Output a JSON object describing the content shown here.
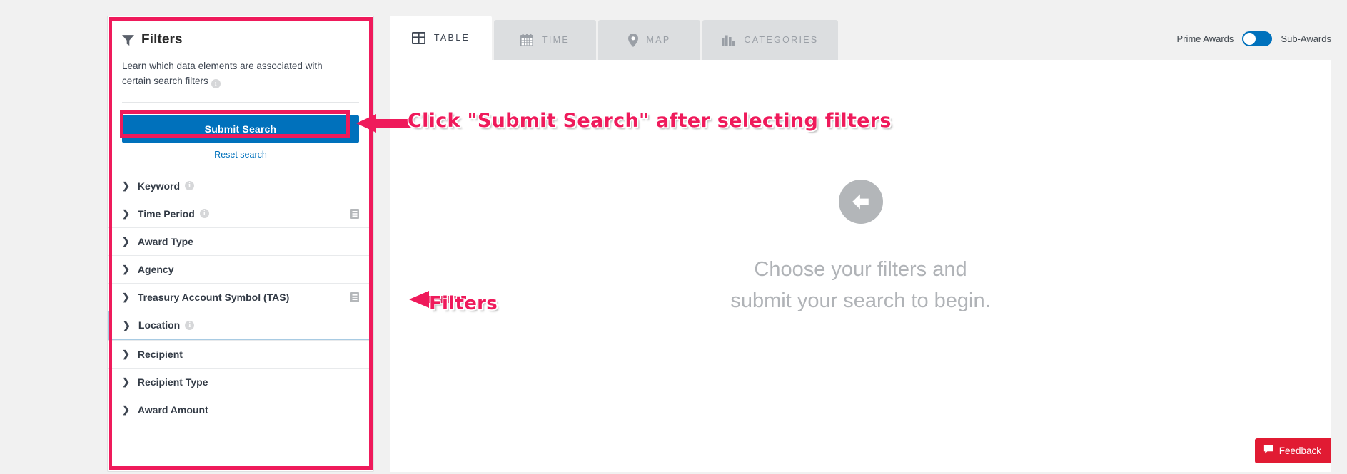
{
  "filters_panel": {
    "title": "Filters",
    "funnel_icon": "funnel-icon",
    "description": "Learn which data elements are associated with certain search filters",
    "info_icon_char": "i",
    "submit_label": "Submit Search",
    "reset_label": "Reset search",
    "accent_color": "#0071bc",
    "items": [
      {
        "label": "Keyword",
        "has_info": true,
        "has_right_icon": false,
        "focused": false
      },
      {
        "label": "Time Period",
        "has_info": true,
        "has_right_icon": true,
        "focused": false
      },
      {
        "label": "Award Type",
        "has_info": false,
        "has_right_icon": false,
        "focused": false
      },
      {
        "label": "Agency",
        "has_info": false,
        "has_right_icon": false,
        "focused": false
      },
      {
        "label": "Treasury Account Symbol (TAS)",
        "has_info": false,
        "has_right_icon": true,
        "focused": false
      },
      {
        "label": "Location",
        "has_info": true,
        "has_right_icon": false,
        "focused": true
      },
      {
        "label": "Recipient",
        "has_info": false,
        "has_right_icon": false,
        "focused": false
      },
      {
        "label": "Recipient Type",
        "has_info": false,
        "has_right_icon": false,
        "focused": false
      },
      {
        "label": "Award Amount",
        "has_info": false,
        "has_right_icon": false,
        "focused": false
      }
    ]
  },
  "results": {
    "tabs": [
      {
        "label": "TABLE",
        "icon": "table-icon",
        "active": true
      },
      {
        "label": "TIME",
        "icon": "calendar-icon",
        "active": false
      },
      {
        "label": "MAP",
        "icon": "map-pin-icon",
        "active": false
      },
      {
        "label": "CATEGORIES",
        "icon": "bar-chart-icon",
        "active": false
      }
    ],
    "toggle": {
      "left_label": "Prime Awards",
      "right_label": "Sub-Awards",
      "state": "prime",
      "color": "#0071bc"
    },
    "empty_state": {
      "icon": "arrow-left-circle-icon",
      "line1": "Choose your filters and",
      "line2": "submit your search to begin."
    }
  },
  "annotations": {
    "color": "#ef1a5b",
    "submit_note": "Click \"Submit Search\" after selecting filters",
    "filters_note": "Filters"
  },
  "feedback": {
    "label": "Feedback",
    "icon": "speech-bubble-icon",
    "color": "#e11b33"
  }
}
